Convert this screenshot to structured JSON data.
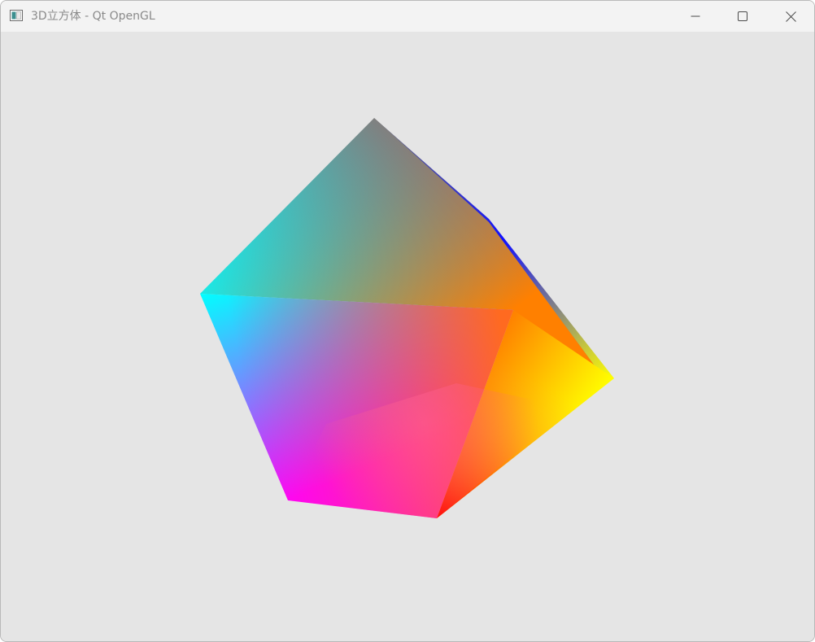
{
  "window": {
    "title": "3D立方体 - Qt OpenGL",
    "icon": "app-window-icon",
    "controls": {
      "minimize_icon": "minimize-icon",
      "maximize_icon": "maximize-icon",
      "close_icon": "close-icon"
    }
  },
  "viewport": {
    "background": "#e5e5e5",
    "content": "rotating-color-cube",
    "vertex_colors": {
      "top": "#808080",
      "left": "#00ffff",
      "right": "#ffff00",
      "bottom_left": "#ff00ff",
      "bottom": "#ff0000",
      "center": "#ff8000",
      "back_edge": "#0000ff"
    }
  }
}
